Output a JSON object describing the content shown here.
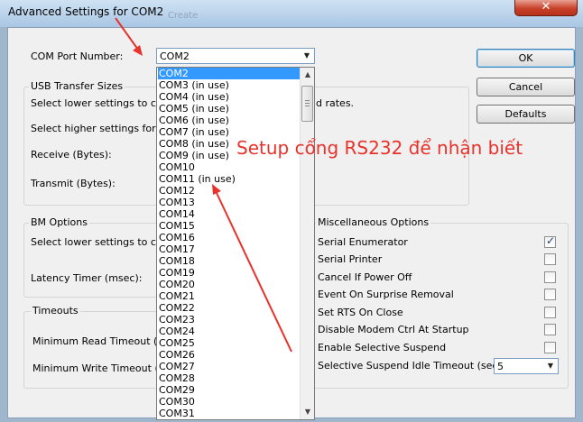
{
  "window": {
    "title": "Advanced Settings for COM2",
    "close_glyph": "✕",
    "background_title": "Create"
  },
  "com_port": {
    "label": "COM Port Number:",
    "value": "COM2",
    "arrow_icon": "▼"
  },
  "usb": {
    "title": "USB Transfer Sizes",
    "line1": "Select lower settings to corre",
    "line1_tail": "d rates.",
    "line2": "Select higher settings for fas",
    "receive_label": "Receive (Bytes):",
    "transmit_label": "Transmit (Bytes):"
  },
  "bm": {
    "title": "BM Options",
    "line1": "Select lower settings to corre",
    "latency_label": "Latency Timer (msec):"
  },
  "timeouts": {
    "title": "Timeouts",
    "read_label": "Minimum Read Timeout (mse",
    "write_label": "Minimum Write Timeout (mse"
  },
  "misc": {
    "title": "Miscellaneous Options",
    "options": [
      {
        "label": "Serial Enumerator",
        "checked": true
      },
      {
        "label": "Serial Printer",
        "checked": false
      },
      {
        "label": "Cancel If Power Off",
        "checked": false
      },
      {
        "label": "Event On Surprise Removal",
        "checked": false
      },
      {
        "label": "Set RTS On Close",
        "checked": false
      },
      {
        "label": "Disable Modem Ctrl At Startup",
        "checked": false
      },
      {
        "label": "Enable Selective Suspend",
        "checked": false
      }
    ],
    "check_glyph": "✓",
    "suspend_label": "Selective Suspend Idle Timeout (secs):",
    "suspend_value": "5",
    "suspend_arrow": "▼"
  },
  "buttons": {
    "ok": "OK",
    "cancel": "Cancel",
    "defaults": "Defaults"
  },
  "dropdown": {
    "selected": "COM2",
    "items": [
      "COM2",
      "COM3 (in use)",
      "COM4 (in use)",
      "COM5 (in use)",
      "COM6 (in use)",
      "COM7 (in use)",
      "COM8 (in use)",
      "COM9 (in use)",
      "COM10",
      "COM11 (in use)",
      "COM12",
      "COM13",
      "COM14",
      "COM15",
      "COM16",
      "COM17",
      "COM18",
      "COM19",
      "COM20",
      "COM21",
      "COM22",
      "COM23",
      "COM24",
      "COM25",
      "COM26",
      "COM27",
      "COM28",
      "COM29",
      "COM30",
      "COM31"
    ],
    "scroll_up": "▲",
    "scroll_down": "▼"
  },
  "annotation": {
    "text": "Setup cổng RS232 để nhận biết",
    "color": "#e8322c"
  }
}
